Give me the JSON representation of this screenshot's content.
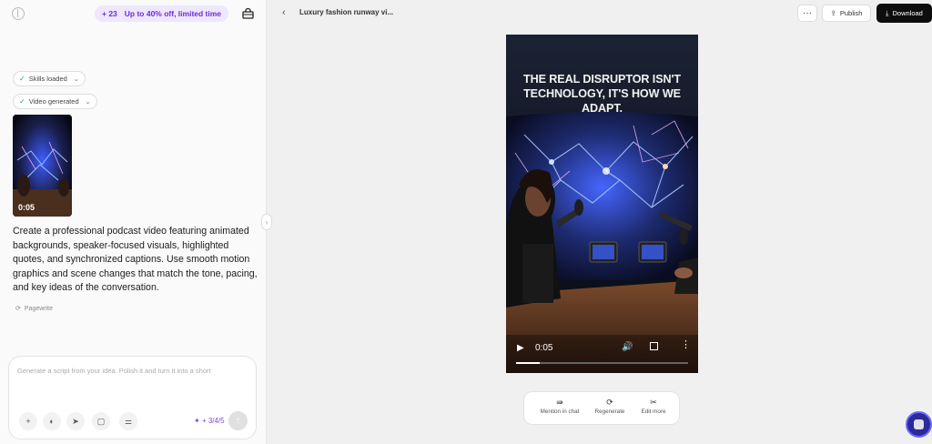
{
  "promo": {
    "count": "+ 23",
    "text": "Up to 40% off, limited time"
  },
  "chat": {
    "pills": {
      "skills": "Skills loaded",
      "video": "Video generated"
    },
    "thumbnail": {
      "caption": "THE REAL DISRUPTOR ISN'T TECHNOLOGY, IT'S HOW WE ADAPT.",
      "duration": "0:05"
    },
    "prompt": "Create a professional podcast video featuring animated backgrounds, speaker-focused visuals, highlighted quotes, and synchronized captions. Use smooth motion graphics and scene changes that match the tone, pacing, and key ideas of the conversation.",
    "rewrite_label": "Pagewrite"
  },
  "composer": {
    "placeholder": "Generate a script from your idea. Polish it and turn it into a short",
    "credits": "+ 3/4/5"
  },
  "header": {
    "title": "Luxury fashion runway vi...",
    "publish_label": "Publish",
    "download_label": "Download"
  },
  "player": {
    "caption_line1": "THE REAL DISRUPTOR ISN'T",
    "caption_line2": "TECHNOLOGY, IT'S HOW WE ADAPT.",
    "time": "0:05",
    "progress": 0.14
  },
  "actions": {
    "mention": "Mention in chat",
    "regenerate": "Regenerate",
    "edit": "Edit more"
  },
  "colors": {
    "accent": "#6b2fd6",
    "dark_button": "#0d0d0d"
  }
}
